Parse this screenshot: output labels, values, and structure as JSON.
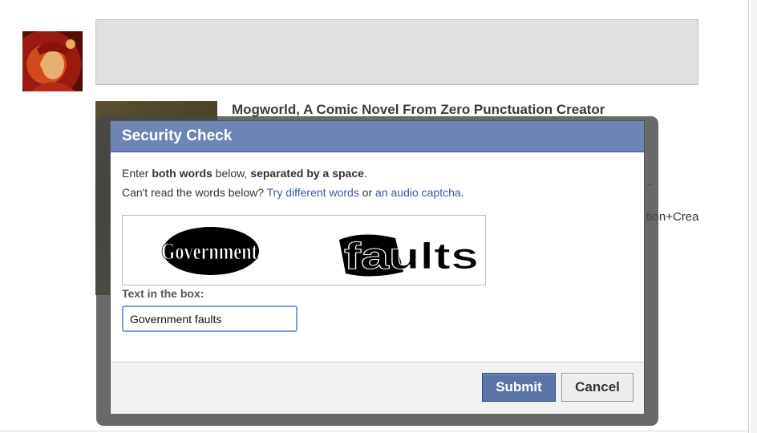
{
  "background_post": {
    "title": "Mogworld, A Comic Novel From Zero Punctuation Creator",
    "fragment": "tion+Crea",
    "dash": "–"
  },
  "dialog": {
    "title": "Security Check",
    "instruction": {
      "part1": "Enter ",
      "part2": "both words",
      "part3": " below, ",
      "part4": "separated by a space",
      "part5": "."
    },
    "help": {
      "prefix": "Can't read the words below? ",
      "link1": "Try different words",
      "middle": " or ",
      "link2": "an audio captcha",
      "suffix": "."
    },
    "captcha": {
      "word1": "Government",
      "word2": "faults"
    },
    "input_label": "Text in the box:",
    "input_value": "Government faults",
    "submit_label": "Submit",
    "cancel_label": "Cancel"
  },
  "colors": {
    "header_blue": "#6d84b4",
    "link_blue": "#3b5998",
    "submit_blue": "#5b74a8",
    "input_focus": "#7ba0db"
  }
}
